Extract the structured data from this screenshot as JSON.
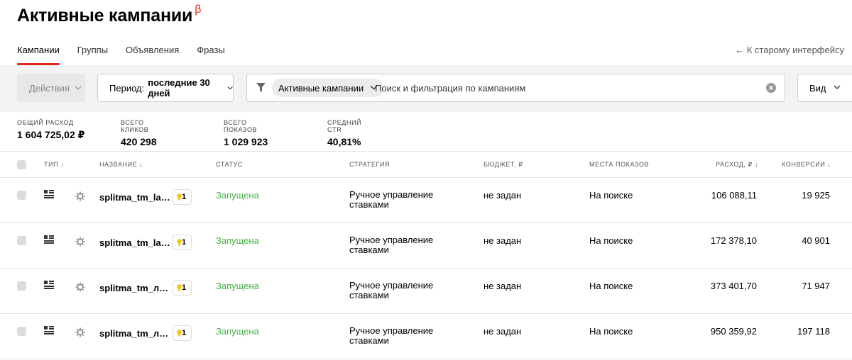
{
  "page": {
    "title": "Активные кампании",
    "title_badge": "β",
    "tabs": [
      {
        "label": "Кампании",
        "active": true
      },
      {
        "label": "Группы",
        "active": false
      },
      {
        "label": "Объявления",
        "active": false
      },
      {
        "label": "Фразы",
        "active": false
      }
    ],
    "old_ui_link": "← К старому интерфейсу"
  },
  "toolbar": {
    "actions_label": "Действия",
    "period_label": "Период:",
    "period_value": "последние 30 дней",
    "filter_chip": "Активные кампании",
    "search_placeholder": "Поиск и фильтрация по кампаниям",
    "view_label": "Вид"
  },
  "stats": [
    {
      "label": "общий расход",
      "value": "1 604 725,02 ₽"
    },
    {
      "label": "всего кликов",
      "value": "420 298"
    },
    {
      "label": "всего показов",
      "value": "1 029 923"
    },
    {
      "label": "средний CTR",
      "value": "40,81%"
    }
  ],
  "table": {
    "headers": {
      "type": "ТИП ↓",
      "name": "НАЗВАНИЕ ↓",
      "status": "СТАТУС",
      "strategy": "СТРАТЕГИЯ",
      "budget": "БЮДЖЕТ, ₽",
      "places": "МЕСТА ПОКАЗОВ",
      "spend": "РАСХОД, ₽ ↓",
      "conversions": "КОНВЕРСИИ ↓"
    },
    "rows": [
      {
        "name": "splitma_tm_lam…",
        "badge": "1",
        "status": "Запущена",
        "strategy": "Ручное управление ставками",
        "budget": "не задан",
        "places": "На поиске",
        "spend": "106 088,11",
        "conversions": "19 925"
      },
      {
        "name": "splitma_tm_lam…",
        "badge": "1",
        "status": "Запущена",
        "strategy": "Ручное управление ставками",
        "budget": "не задан",
        "places": "На поиске",
        "spend": "172 378,10",
        "conversions": "40 901"
      },
      {
        "name": "splitma_tm_лам…",
        "badge": "1",
        "status": "Запущена",
        "strategy": "Ручное управление ставками",
        "budget": "не задан",
        "places": "На поиске",
        "spend": "373 401,70",
        "conversions": "71 947"
      },
      {
        "name": "splitma_tm_лам…",
        "badge": "1",
        "status": "Запущена",
        "strategy": "Ручное управление ставками",
        "budget": "не задан",
        "places": "На поиске",
        "spend": "950 359,92",
        "conversions": "197 118"
      }
    ]
  },
  "colors": {
    "accent": "#e52620",
    "status_active": "#46b046"
  },
  "icons": [
    "filter-icon",
    "chevron-down-icon",
    "clear-icon",
    "list-icon",
    "gear-icon",
    "bulb-icon"
  ]
}
